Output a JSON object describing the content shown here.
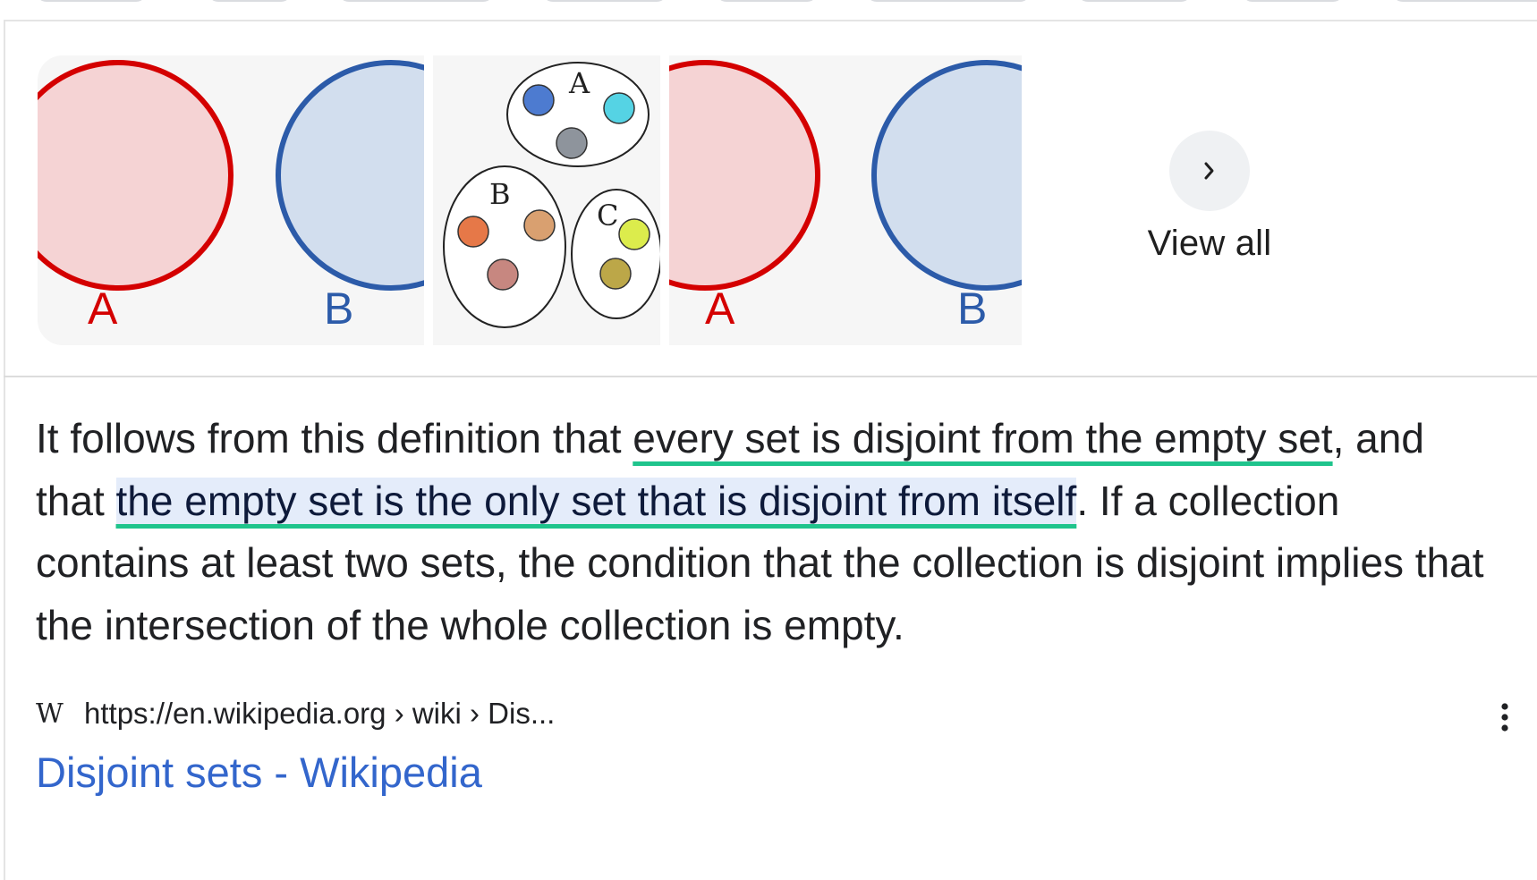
{
  "gallery": {
    "image1": {
      "label_a": "A",
      "label_b": "B"
    },
    "image2": {
      "label_a": "A",
      "label_b": "B",
      "label_c": "C"
    },
    "image3": {
      "label_a": "A",
      "label_b": "B"
    },
    "view_all_label": "View all",
    "view_all_icon": "chevron-right-icon"
  },
  "snippet": {
    "part1": "It follows from this definition that ",
    "underlined": "every set is disjoint from the empty set",
    "part2": ", and that ",
    "highlighted": "the empty set is the only set that is disjoint from itself",
    "part3": ". If a collection contains at least two sets, the condition that the collection is disjoint implies that the intersection of the whole collection is empty."
  },
  "source": {
    "favicon": "W",
    "url": "https://en.wikipedia.org › wiki › Dis...",
    "title": "Disjoint sets - Wikipedia"
  },
  "colors": {
    "set_a_stroke": "#d40000",
    "set_a_fill": "#f5d3d4",
    "set_b_stroke": "#2c5ba9",
    "set_b_fill": "#d2deee",
    "underline": "#1fc48c",
    "highlight_bg": "#e4ecfa",
    "link": "#3366cc"
  }
}
